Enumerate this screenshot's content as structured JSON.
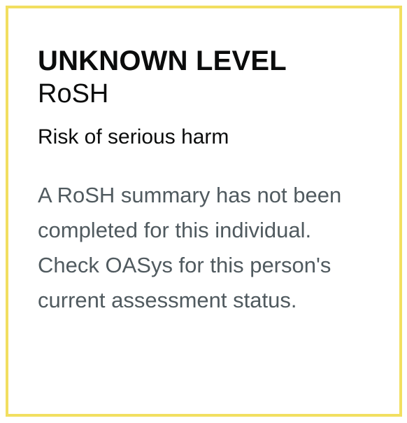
{
  "risk_card": {
    "level": "UNKNOWN LEVEL",
    "label": "RoSH",
    "description": "Risk of serious harm",
    "message": "A RoSH summary has not been completed for this individual. Check OASys for this person's current assessment status.",
    "border_color": "#f2df60",
    "text_color": "#0b0c0c",
    "secondary_text_color": "#505a5f"
  }
}
